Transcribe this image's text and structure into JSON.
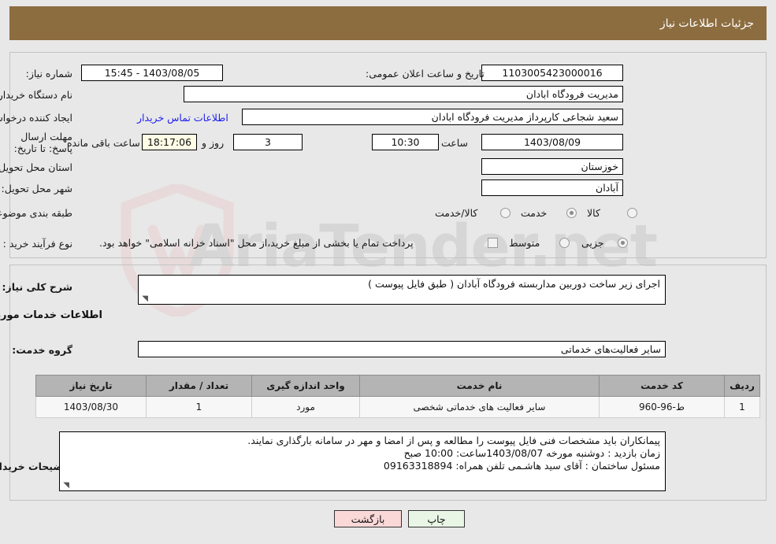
{
  "header": {
    "title": "جزئیات اطلاعات نیاز",
    "bg_color": "#8c6d40"
  },
  "watermark": {
    "text": "AriaTender.net"
  },
  "form": {
    "need_number_label": "شماره نیاز:",
    "need_number_value": "1103005423000016",
    "announce_datetime_label": "تاریخ و ساعت اعلان عمومی:",
    "announce_datetime_value": "1403/08/05 - 15:45",
    "buyer_org_label": "نام دستگاه خریدار:",
    "buyer_org_value": "مدیریت فرودگاه ابادان",
    "creator_label": "ایجاد کننده درخواست:",
    "creator_value": "سعید شجاعی کارپرداز مدیریت فرودگاه ابادان",
    "contact_link": "اطلاعات تماس خریدار",
    "deadline_label": "مهلت ارسال پاسخ: تا تاریخ:",
    "deadline_date": "1403/08/09",
    "deadline_hour_label": "ساعت",
    "deadline_hour_value": "10:30",
    "remaining_days": "3",
    "remaining_days_suffix": "روز و",
    "remaining_time": "18:17:06",
    "remaining_time_suffix": "ساعت باقی مانده",
    "province_label": "استان محل تحویل:",
    "province_value": "خوزستان",
    "city_label": "شهر محل تحویل:",
    "city_value": "آبادان",
    "category_label": "طبقه بندی موضوعی:",
    "category_options": [
      {
        "label": "کالا",
        "selected": false
      },
      {
        "label": "خدمت",
        "selected": true
      },
      {
        "label": "کالا/خدمت",
        "selected": false
      }
    ],
    "process_label": "نوع فرآیند خرید :",
    "process_options": [
      {
        "label": "جزیی",
        "selected": true
      },
      {
        "label": "متوسط",
        "selected": false
      }
    ],
    "treasury_checkbox_label": "پرداخت تمام یا بخشی از مبلغ خرید،از محل \"اسناد خزانه اسلامی\" خواهد بود.",
    "treasury_checked": false,
    "general_desc_label": "شرح کلی نیاز:",
    "general_desc_value": "اجرای زیر ساخت دوربین مداربسته فرودگاه آبادان ( طبق فایل پیوست )",
    "services_section_title": "اطلاعات خدمات مورد نیاز",
    "service_group_label": "گروه خدمت:",
    "service_group_value": "سایر فعالیت‌های خدماتی",
    "buyer_notes_label": "توضیحات خریدار:",
    "buyer_notes_lines": [
      "پیمانکاران باید مشخصات فنی فایل  پیوست را مطالعه و پس از امضا و مهر در سامانه بارگذاری نمایند.",
      "زمان بازدید : دوشنبه مورخه 1403/08/07ساعت:  10:00 صبح",
      "مسئول ساختمان : آقای سید هاشـمی  تلفن همراه: 09163318894"
    ]
  },
  "table": {
    "columns": [
      "ردیف",
      "کد خدمت",
      "نام خدمت",
      "واحد اندازه گیری",
      "تعداد / مقدار",
      "تاریخ نیاز"
    ],
    "rows": [
      {
        "index": "1",
        "code": "ط-96-960",
        "name": "سایر فعالیت های خدماتی شخصی",
        "unit": "مورد",
        "qty": "1",
        "date": "1403/08/30"
      }
    ]
  },
  "buttons": {
    "print": "چاپ",
    "back": "بازگشت"
  }
}
